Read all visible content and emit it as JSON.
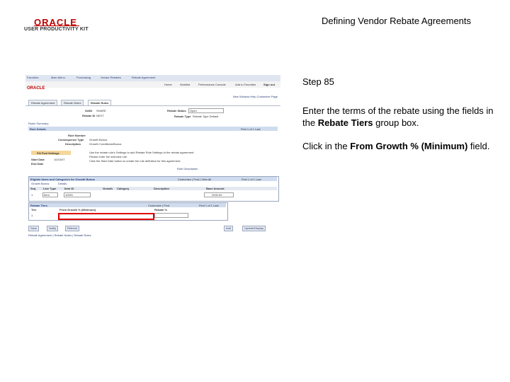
{
  "logo": {
    "brand": "ORACLE",
    "product": "USER PRODUCTIVITY KIT"
  },
  "doc_title": "Defining Vendor Rebate Agreements",
  "instructions": {
    "step": "Step 85",
    "p1_prefix": "Enter the terms of the rebate using the fields in the ",
    "p1_bold": "Rebate Tiers",
    "p1_suffix": " group box.",
    "p2_prefix": "Click in the ",
    "p2_bold": "From Growth % (Minimum)",
    "p2_suffix": " field."
  },
  "screenshot": {
    "nav": [
      "Favorites",
      "Main Menu",
      "Purchasing",
      "Vendor Rebates",
      "Rebate Agreement"
    ],
    "universal": [
      "Home",
      "Worklist",
      "Performance Console",
      "Add to Favorites",
      "Sign out"
    ],
    "ps_logo": "ORACLE",
    "row_links": "New Window   Help   Customize Page",
    "tabs": [
      "Rebate Agreement",
      "Rebate Notes",
      "Rebate Rules"
    ],
    "setid_label": "SetID",
    "setid_value": "SHARE",
    "rebate_id_label": "Rebate ID",
    "rebate_id_value": "NEXT",
    "status_label": "Rebate Status",
    "status_value": "Open",
    "rebate_type_label": "Rebate Type",
    "rebate_type_value": "Rebate Type Default",
    "rules_summary": "Rules Summary",
    "rule_details": "Rule Details",
    "pager": "First  1 of 1  Last",
    "rule_number_label": "Rule Number",
    "consequence_label": "Consequence Type",
    "consequence_value": "Growth Bonus",
    "description_label": "Description",
    "description_value": "Growth Conditions/Bonus",
    "fill_btn": "Fill Fwd Settings",
    "note_line1": "Use the rebate rule's Settings to add Rebate Rule Settings to the rebate agreement.",
    "note_line2": "Please enter the selected rule.",
    "note_line3": "Click the Start Date button to create the rule definition for this agreement.",
    "start_date_label": "Start Date",
    "start_date_value": "10/10/07",
    "end_date_label": "End Date",
    "rule_description_link": "Rule Description",
    "eligible_title": "Eligible Items and Categories for Growth Bonus",
    "find": "Customize | Find | View All",
    "subtabs": [
      "Growth Bonus",
      "Details"
    ],
    "col_headers": [
      "Seq",
      "Line Type",
      "Item ID",
      "Growth",
      "Category",
      "Description",
      "Base Amount"
    ],
    "row": [
      "1",
      "Item",
      "10001",
      "",
      "",
      "",
      "2000.00"
    ],
    "rebate_tiers_title": "Rebate Tiers",
    "tiers_find": "Customize | Find",
    "tiers_pager": "First  1 of 1  Last",
    "tier_headers": [
      "Tier",
      "From Growth % (Minimum)",
      "Rebate %"
    ],
    "tier_row_num": "1",
    "buttons": [
      "Save",
      "Notify",
      "Refresh"
    ],
    "buttons_right": [
      "Add",
      "Update/Display"
    ],
    "footer_links": "Rebate Agreement | Rebate Notes | Rebate Rules"
  }
}
